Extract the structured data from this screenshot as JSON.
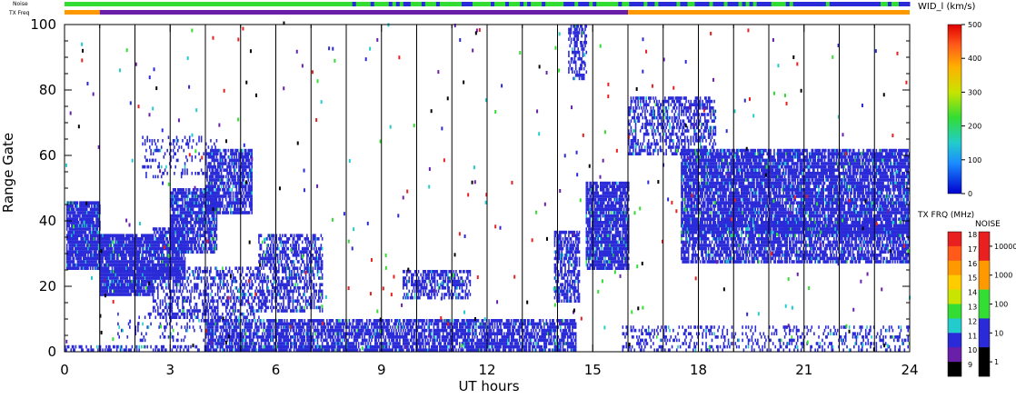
{
  "chart_data": {
    "type": "heatmap",
    "title": "",
    "xlabel": "UT hours",
    "ylabel": "Range Gate",
    "xlim": [
      0,
      24
    ],
    "ylim": [
      0,
      100
    ],
    "x_ticks": [
      "0",
      "3",
      "6",
      "9",
      "12",
      "15",
      "18",
      "21",
      "24"
    ],
    "y_ticks": [
      "0",
      "20",
      "40",
      "60",
      "80",
      "100"
    ],
    "grid": "vertical lines every hour",
    "top_bars": {
      "noise_label": "Noise",
      "txfreq_label": "TX Freq",
      "txfreq_segments": [
        {
          "start": 0,
          "end": 1,
          "color": "#ff9900"
        },
        {
          "start": 1,
          "end": 16,
          "color": "#6a1fa8"
        },
        {
          "start": 16,
          "end": 24,
          "color": "#ff9900"
        }
      ],
      "noise_colors": [
        "#33dd33",
        "#2a2ad8"
      ]
    },
    "colorbar_width": {
      "label": "WID_l (km/s)",
      "ticks": [
        "500",
        "400",
        "300",
        "200",
        "100",
        "0"
      ],
      "range": [
        0,
        500
      ]
    },
    "colorbar_txfreq": {
      "label": "TX FRQ (MHz)",
      "ticks": [
        "18",
        "17",
        "16",
        "15",
        "14",
        "13",
        "12",
        "11",
        "10",
        "9"
      ],
      "colors": [
        "#e82020",
        "#ff5a1a",
        "#ff9900",
        "#ffcc00",
        "#c8e400",
        "#33dd33",
        "#22cccc",
        "#2a2ad8",
        "#6a1fa8",
        "#000000"
      ]
    },
    "colorbar_noise": {
      "label": "NOISE",
      "ticks": [
        "10000",
        "1000",
        "100",
        "10",
        "1"
      ],
      "colors": [
        "#e82020",
        "#ff9900",
        "#33dd33",
        "#2a2ad8",
        "#000000"
      ]
    },
    "regions": [
      {
        "x0": 0.05,
        "x1": 1.0,
        "y0": 25,
        "y1": 46,
        "color": "#2a2ad8",
        "density": 0.92
      },
      {
        "x0": 1.0,
        "x1": 2.5,
        "y0": 17,
        "y1": 36,
        "color": "#2a2ad8",
        "density": 0.9
      },
      {
        "x0": 2.5,
        "x1": 3.4,
        "y0": 22,
        "y1": 38,
        "color": "#2a2ad8",
        "density": 0.85
      },
      {
        "x0": 3.0,
        "x1": 4.3,
        "y0": 30,
        "y1": 50,
        "color": "#2a2ad8",
        "density": 0.75
      },
      {
        "x0": 4.0,
        "x1": 5.3,
        "y0": 42,
        "y1": 62,
        "color": "#2a2ad8",
        "density": 0.72
      },
      {
        "x0": 2.2,
        "x1": 4.3,
        "y0": 53,
        "y1": 66,
        "color": "#2a2ad8",
        "density": 0.18
      },
      {
        "x0": 5.5,
        "x1": 7.3,
        "y0": 12,
        "y1": 36,
        "color": "#2a2ad8",
        "density": 0.55
      },
      {
        "x0": 2.5,
        "x1": 5.5,
        "y0": 10,
        "y1": 26,
        "color": "#2a2ad8",
        "density": 0.42
      },
      {
        "x0": 1.5,
        "x1": 4.0,
        "y0": 3,
        "y1": 12,
        "color": "#2a2ad8",
        "density": 0.15
      },
      {
        "x0": 0.0,
        "x1": 8.0,
        "y0": 0,
        "y1": 2,
        "color": "#2a2ad8",
        "density": 0.45
      },
      {
        "x0": 4.0,
        "x1": 14.5,
        "y0": 0,
        "y1": 10,
        "color": "#2a2ad8",
        "density": 0.72
      },
      {
        "x0": 9.6,
        "x1": 11.5,
        "y0": 16,
        "y1": 25,
        "color": "#2a2ad8",
        "density": 0.55
      },
      {
        "x0": 13.9,
        "x1": 14.6,
        "y0": 15,
        "y1": 37,
        "color": "#2a2ad8",
        "density": 0.65
      },
      {
        "x0": 14.3,
        "x1": 14.8,
        "y0": 83,
        "y1": 100,
        "color": "#2a2ad8",
        "density": 0.45
      },
      {
        "x0": 14.8,
        "x1": 16.0,
        "y0": 25,
        "y1": 52,
        "color": "#2a2ad8",
        "density": 0.85
      },
      {
        "x0": 16.0,
        "x1": 18.5,
        "y0": 60,
        "y1": 78,
        "color": "#2a2ad8",
        "density": 0.5
      },
      {
        "x0": 17.5,
        "x1": 24.0,
        "y0": 36,
        "y1": 62,
        "color": "#2a2ad8",
        "density": 0.82
      },
      {
        "x0": 17.5,
        "x1": 24.0,
        "y0": 27,
        "y1": 39,
        "color": "#2a2ad8",
        "density": 0.72
      },
      {
        "x0": 15.8,
        "x1": 24.0,
        "y0": 0,
        "y1": 8,
        "color": "#2a2ad8",
        "density": 0.25
      }
    ]
  }
}
